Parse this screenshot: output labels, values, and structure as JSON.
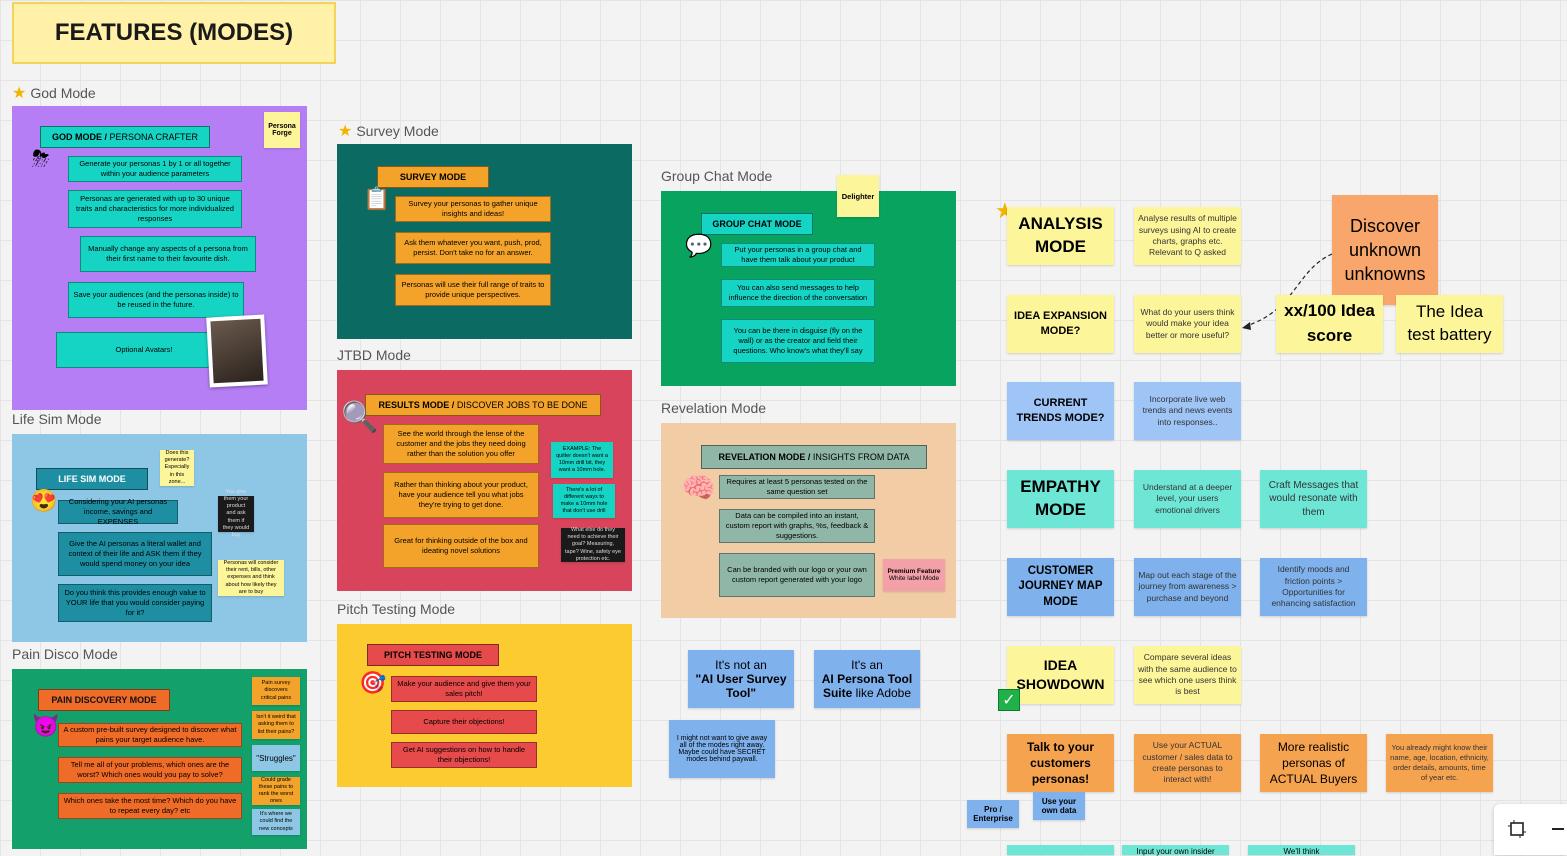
{
  "title": "FEATURES (MODES)",
  "frames": {
    "god": "God Mode",
    "life": "Life Sim Mode",
    "pain": "Pain Disco Mode",
    "survey": "Survey Mode",
    "jtbd": "JTBD Mode",
    "pitch": "Pitch Testing Mode",
    "group": "Group Chat Mode",
    "revelation": "Revelation Mode"
  },
  "god": {
    "header_bold": "GOD MODE / ",
    "header_rest": "PERSONA CRAFTER",
    "tag": "Persona Forge",
    "items": [
      "Generate your personas 1 by 1 or all together within your audience parameters",
      "Personas are generated with up to 30 unique traits and characteristics for more individualized responses",
      "Manually change any aspects of a persona from their first name to their favourite dish.",
      "Save your audiences (and the personas inside) to be reused in the future.",
      "Optional Avatars!"
    ]
  },
  "life": {
    "header": "LIFE SIM MODE",
    "items": [
      "Considering your AI personas income, savings and EXPENSES",
      "Give the AI personas a literal wallet and context of their life and ASK them if they would spend money on your idea",
      "Do you think this provides enough value to YOUR life that you would consider paying for it?"
    ],
    "notes": [
      "Does this generate? Especially in this zone...",
      "You give them your product and ask them if they would buy",
      "Personas will consider their rent, bills, other expenses and think about how likely they are to buy"
    ]
  },
  "pain": {
    "header": "PAIN DISCOVERY MODE",
    "items": [
      "A custom pre-built survey designed to discover what pains your target audience have.",
      "Tell me all of your problems, which ones are the worst? Which ones would you pay to solve?",
      "Which ones take the most time? Which do you have to repeat every day? etc"
    ],
    "notes": [
      "Pain survey discovers critical pains",
      "Isn't it weird that asking them to list their pains?",
      "\"Struggles\"",
      "Could grade these pains to rank the worst ones",
      "It's where we could find the new concepts"
    ]
  },
  "survey": {
    "header": "SURVEY MODE",
    "items": [
      "Survey your personas to gather unique insights and ideas!",
      "Ask them whatever you want, push, prod, persist. Don't take no for an answer.",
      "Personas will use their full range of traits to provide unique perspectives."
    ]
  },
  "jtbd": {
    "header_bold": "RESULTS MODE / ",
    "header_rest": "DISCOVER JOBS TO BE DONE",
    "items": [
      "See the world through the lense of the customer and the jobs they need doing rather than the solution you offer",
      "Rather than thinking about your product, have your audience tell you what jobs they're trying to get done.",
      "Great for thinking outside of the box and ideating novel solutions"
    ],
    "notes": [
      "EXAMPLE: The quilter doesn't want a 10mm drill bit, they want a 10mm hole.",
      "There's a lot of different ways to make a 10mm hole that don't use drill",
      "What else do they need to achieve their goal? Measuring, tape? Wine, safety eye protection etc."
    ]
  },
  "pitch": {
    "header": "PITCH TESTING MODE",
    "items": [
      "Make your audience and give them your sales pitch!",
      "Capture their objections!",
      "Get AI suggestions on how to handle their objections!"
    ]
  },
  "group": {
    "header": "GROUP CHAT MODE",
    "tag": "Delighter",
    "items": [
      "Put your personas in a group chat and have them talk about your product",
      "You can also send messages to help influence the direction of the conversation",
      "You can be there in disguise (fly on the wall) or as the creator and field their questions. Who know's what they'll say"
    ]
  },
  "revelation": {
    "header_bold": "REVELATION MODE / ",
    "header_rest": "INSIGHTS FROM DATA",
    "items": [
      "Requires at least 5 personas tested on the same question set",
      "Data can be compiled into an instant, custom report with graphs, %s, feedback & suggestions.",
      "Can be branded with our logo or your own custom report generated with your logo"
    ],
    "premium": "Premium Feature",
    "premium_sub": "White label Mode"
  },
  "positioning": {
    "not_a_pre": "It's not an",
    "not_a": "\"AI User Survey Tool\"",
    "its_an_pre": "It's an",
    "its_an_bold": "AI Persona Tool Suite",
    "its_an_rest": " like Adobe",
    "paywall": "I might not want to give away all of the modes right away. Maybe could have SECRET modes behind paywall."
  },
  "right": {
    "analysis": "ANALYSIS MODE",
    "analysis_desc": "Analyse results of multiple surveys using AI to create charts, graphs etc. Relevant to Q asked",
    "discover": "Discover unknown unknowns",
    "idea_exp": "IDEA EXPANSION MODE?",
    "idea_exp_desc": "What do your users think would make your idea better or more useful?",
    "idea_score": "xx/100 Idea score",
    "idea_battery": "The Idea test battery",
    "trends": "CURRENT TRENDS MODE?",
    "trends_desc": "Incorporate live web trends and news events into responses..",
    "empathy": "EMPATHY MODE",
    "empathy_desc": "Understand at a deeper level, your users emotional drivers",
    "empathy_desc2": "Craft Messages that would resonate with them",
    "journey": "CUSTOMER JOURNEY MAP MODE",
    "journey_desc": "Map out each stage of the journey from awareness > purchase and beyond",
    "journey_desc2": "Identify moods and friction points > Opportunities for enhancing satisfaction",
    "showdown": "IDEA SHOWDOWN",
    "showdown_desc": "Compare several ideas with the same audience to see which one users think is best",
    "talk": "Talk to your customers personas!",
    "talk_desc": "Use your ACTUAL customer / sales data to create personas to interact with!",
    "talk_desc2": "More realistic personas of ACTUAL Buyers",
    "talk_desc3": "You already might know their name, age, location, ethnicity, order details, amounts, time of year etc.",
    "pro": "Pro / Enterprise",
    "own_data": "Use your own data",
    "bottom": [
      "",
      "Input your own insider",
      "We'll think"
    ]
  },
  "colors": {
    "god": "#b57ef5",
    "life": "#8ec7e6",
    "pain": "#13a06a",
    "survey": "#0b6a61",
    "jtbd": "#d8445c",
    "pitch": "#fccb2f",
    "group": "#08a35e",
    "revelation": "#f1cca4",
    "teal": "#16d4c4",
    "orange": "#f4a32a",
    "sticky_yellow": "#fdf59a"
  }
}
